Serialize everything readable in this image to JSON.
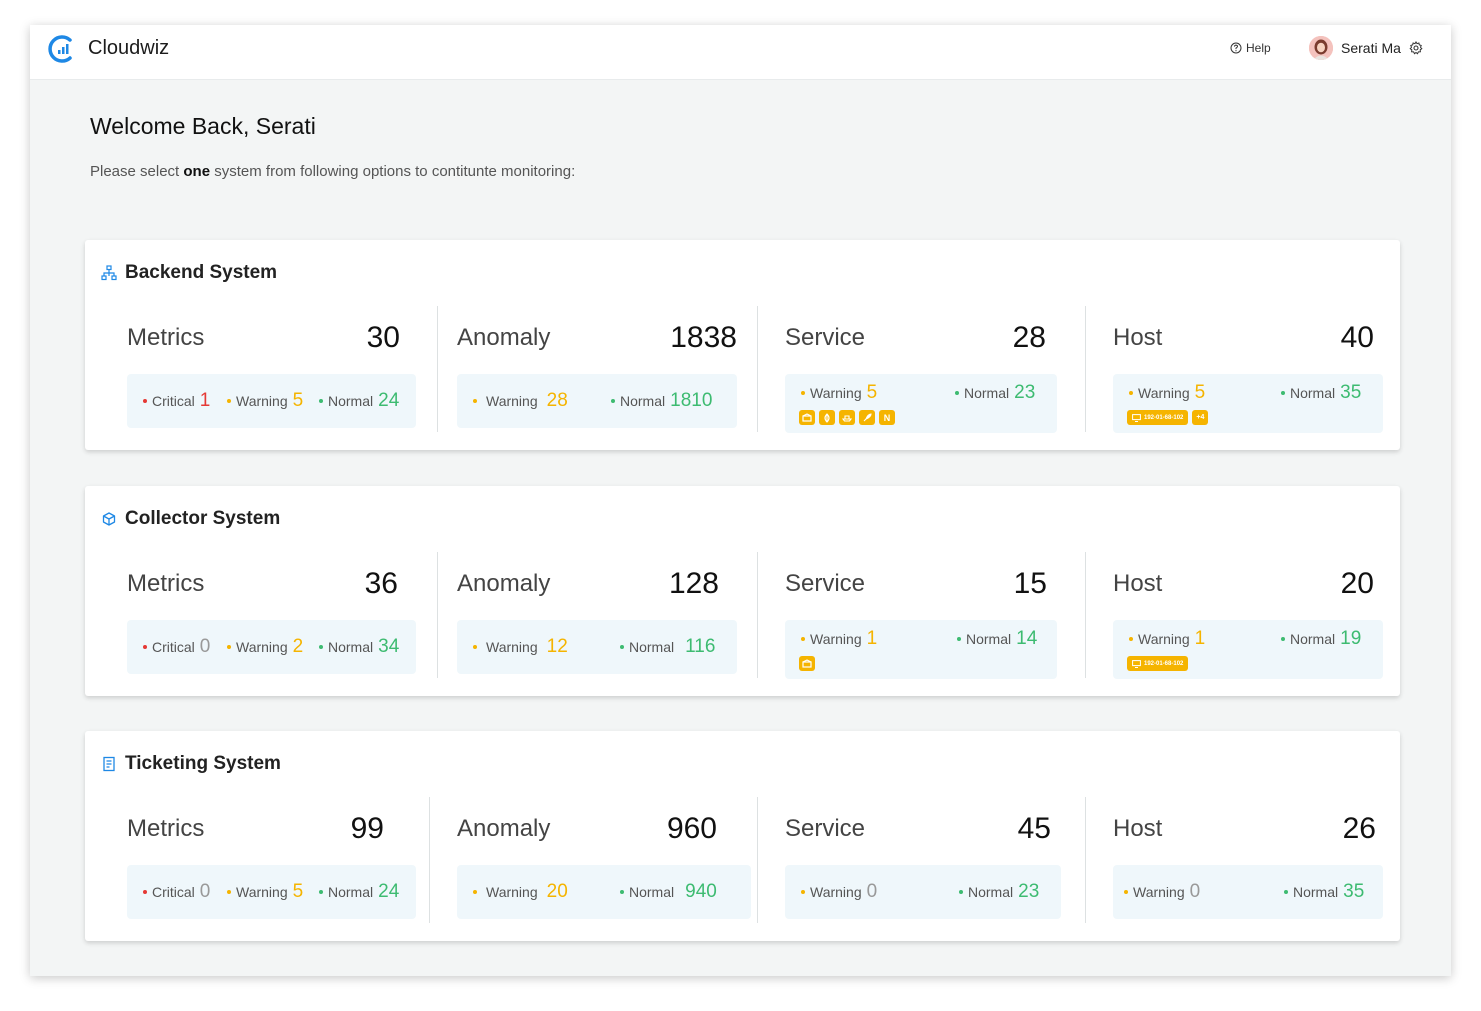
{
  "topbar": {
    "brand": "Cloudwiz",
    "help_label": "Help",
    "user_name": "Serati Ma"
  },
  "welcome": {
    "title": "Welcome Back, Serati",
    "subtitle_pre": "Please select ",
    "subtitle_bold": "one",
    "subtitle_post": " system from following options to contitunte monitoring:"
  },
  "systems": [
    {
      "title": "Backend System",
      "icon": "sitemap-icon",
      "metrics": {
        "label": "Metrics",
        "total": "30",
        "critical_label": "Critical",
        "critical": "1",
        "warning_label": "Warning",
        "warning": "5",
        "normal_label": "Normal",
        "normal": "24"
      },
      "anomaly": {
        "label": "Anomaly",
        "total": "1838",
        "warning_label": "Warning",
        "warning": "28",
        "normal_label": "Normal",
        "normal": "1810"
      },
      "service": {
        "label": "Service",
        "total": "28",
        "warning_label": "Warning",
        "warning": "5",
        "normal_label": "Normal",
        "normal": "23",
        "chips": [
          "box-icon",
          "leaf-icon",
          "boat-icon",
          "feather-icon",
          "N"
        ]
      },
      "host": {
        "label": "Host",
        "total": "40",
        "warning_label": "Warning",
        "warning": "5",
        "normal_label": "Normal",
        "normal": "35",
        "ip_chip": "192-01-68-102",
        "more_chip": "+4"
      }
    },
    {
      "title": "Collector System",
      "icon": "cube-icon",
      "metrics": {
        "label": "Metrics",
        "total": "36",
        "critical_label": "Critical",
        "critical": "0",
        "warning_label": "Warning",
        "warning": "2",
        "normal_label": "Normal",
        "normal": "34"
      },
      "anomaly": {
        "label": "Anomaly",
        "total": "128",
        "warning_label": "Warning",
        "warning": "12",
        "normal_label": "Normal",
        "normal": "116"
      },
      "service": {
        "label": "Service",
        "total": "15",
        "warning_label": "Warning",
        "warning": "1",
        "normal_label": "Normal",
        "normal": "14",
        "chips": [
          "box-icon"
        ]
      },
      "host": {
        "label": "Host",
        "total": "20",
        "warning_label": "Warning",
        "warning": "1",
        "normal_label": "Normal",
        "normal": "19",
        "ip_chip": "192-01-68-102"
      }
    },
    {
      "title": "Ticketing System",
      "icon": "document-icon",
      "metrics": {
        "label": "Metrics",
        "total": "99",
        "critical_label": "Critical",
        "critical": "0",
        "warning_label": "Warning",
        "warning": "5",
        "normal_label": "Normal",
        "normal": "24"
      },
      "anomaly": {
        "label": "Anomaly",
        "total": "960",
        "warning_label": "Warning",
        "warning": "20",
        "normal_label": "Normal",
        "normal": "940"
      },
      "service": {
        "label": "Service",
        "total": "45",
        "warning_label": "Warning",
        "warning": "0",
        "normal_label": "Normal",
        "normal": "23"
      },
      "host": {
        "label": "Host",
        "total": "26",
        "warning_label": "Warning",
        "warning": "0",
        "normal_label": "Normal",
        "normal": "35"
      }
    }
  ],
  "colors": {
    "accent": "#1e88e5",
    "critical": "#e53935",
    "warning": "#f5b400",
    "normal": "#3dbb71",
    "stat_bg": "#eff7fb"
  }
}
